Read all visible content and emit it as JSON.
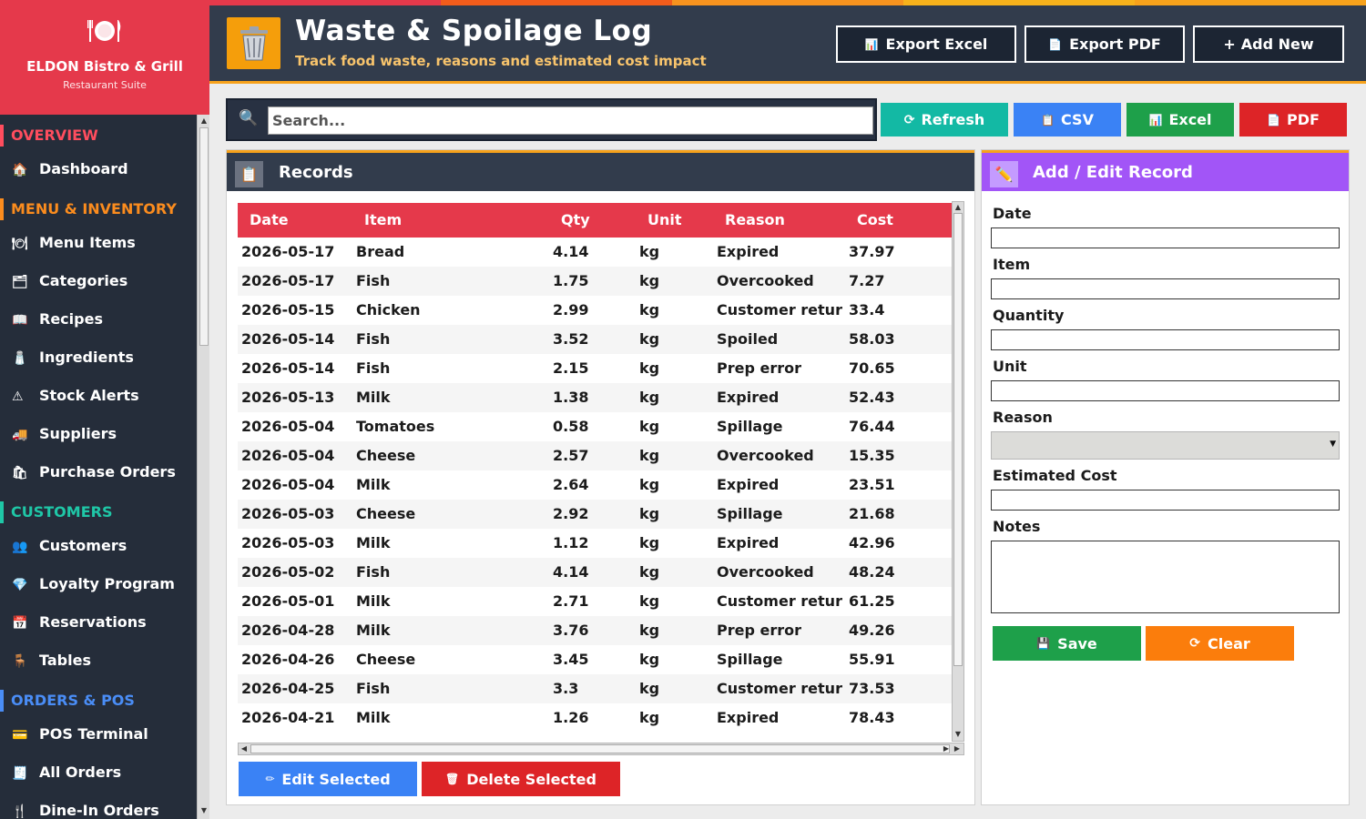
{
  "brand": {
    "logo_icon": "plate-cutlery-icon",
    "name": "ELDON Bistro & Grill",
    "subtitle": "Restaurant Suite",
    "color": "#e5394b"
  },
  "sidebar": {
    "sections": [
      {
        "label": "OVERVIEW",
        "color": "#ff4d5e",
        "items": [
          {
            "icon": "🏠",
            "icon_name": "home-icon",
            "label": "Dashboard"
          }
        ]
      },
      {
        "label": "MENU & INVENTORY",
        "color": "#fb8c1e",
        "items": [
          {
            "icon": "🍽",
            "icon_name": "plate-icon",
            "label": "Menu Items"
          },
          {
            "icon": "🗂",
            "icon_name": "folder-icon",
            "label": "Categories"
          },
          {
            "icon": "📖",
            "icon_name": "book-icon",
            "label": "Recipes"
          },
          {
            "icon": "🧂",
            "icon_name": "ingredient-icon",
            "label": "Ingredients"
          },
          {
            "icon": "⚠",
            "icon_name": "warning-icon",
            "label": "Stock Alerts"
          },
          {
            "icon": "🚚",
            "icon_name": "truck-icon",
            "label": "Suppliers"
          },
          {
            "icon": "🛍",
            "icon_name": "shopping-bag-icon",
            "label": "Purchase Orders"
          }
        ]
      },
      {
        "label": "CUSTOMERS",
        "color": "#1fc7a7",
        "items": [
          {
            "icon": "👥",
            "icon_name": "users-icon",
            "label": "Customers"
          },
          {
            "icon": "💎",
            "icon_name": "diamond-icon",
            "label": "Loyalty Program"
          },
          {
            "icon": "📅",
            "icon_name": "calendar-icon",
            "label": "Reservations"
          },
          {
            "icon": "🪑",
            "icon_name": "chair-icon",
            "label": "Tables"
          }
        ]
      },
      {
        "label": "ORDERS & POS",
        "color": "#4a8df6",
        "items": [
          {
            "icon": "💳",
            "icon_name": "card-icon",
            "label": "POS Terminal"
          },
          {
            "icon": "🧾",
            "icon_name": "receipt-icon",
            "label": "All Orders"
          },
          {
            "icon": "🍴",
            "icon_name": "cutlery-icon",
            "label": "Dine-In Orders"
          }
        ]
      }
    ]
  },
  "header": {
    "icon": "trash-bin-icon",
    "title": "Waste & Spoilage Log",
    "subtitle": "Track food waste, reasons and estimated cost impact",
    "buttons": [
      {
        "icon": "📊",
        "label": "Export Excel"
      },
      {
        "icon": "📄",
        "label": "Export PDF"
      },
      {
        "icon": "+",
        "label": "Add New"
      }
    ],
    "stripe_colors": [
      "#e5394b",
      "#f25c1b",
      "#f7931e",
      "#f7b21b",
      "#f7a21b"
    ]
  },
  "toolbar": {
    "search_placeholder": "Search...",
    "search_icon": "magnifier-icon",
    "buttons": [
      {
        "icon": "⟳",
        "label": "Refresh",
        "color": "#13b9a4"
      },
      {
        "icon": "📋",
        "label": "CSV",
        "color": "#3a82f5"
      },
      {
        "icon": "📊",
        "label": "Excel",
        "color": "#1ea04a"
      },
      {
        "icon": "📄",
        "label": "PDF",
        "color": "#dd2427"
      }
    ]
  },
  "records": {
    "title": "Records",
    "icon": "clipboard-icon",
    "columns": [
      "Date",
      "Item",
      "Qty",
      "Unit",
      "Reason",
      "Cost"
    ],
    "rows": [
      [
        "2026-05-17",
        "Bread",
        "4.14",
        "kg",
        "Expired",
        "37.97"
      ],
      [
        "2026-05-17",
        "Fish",
        "1.75",
        "kg",
        "Overcooked",
        "7.27"
      ],
      [
        "2026-05-15",
        "Chicken",
        "2.99",
        "kg",
        "Customer return",
        "33.4"
      ],
      [
        "2026-05-14",
        "Fish",
        "3.52",
        "kg",
        "Spoiled",
        "58.03"
      ],
      [
        "2026-05-14",
        "Fish",
        "2.15",
        "kg",
        "Prep error",
        "70.65"
      ],
      [
        "2026-05-13",
        "Milk",
        "1.38",
        "kg",
        "Expired",
        "52.43"
      ],
      [
        "2026-05-04",
        "Tomatoes",
        "0.58",
        "kg",
        "Spillage",
        "76.44"
      ],
      [
        "2026-05-04",
        "Cheese",
        "2.57",
        "kg",
        "Overcooked",
        "15.35"
      ],
      [
        "2026-05-04",
        "Milk",
        "2.64",
        "kg",
        "Expired",
        "23.51"
      ],
      [
        "2026-05-03",
        "Cheese",
        "2.92",
        "kg",
        "Spillage",
        "21.68"
      ],
      [
        "2026-05-03",
        "Milk",
        "1.12",
        "kg",
        "Expired",
        "42.96"
      ],
      [
        "2026-05-02",
        "Fish",
        "4.14",
        "kg",
        "Overcooked",
        "48.24"
      ],
      [
        "2026-05-01",
        "Milk",
        "2.71",
        "kg",
        "Customer return",
        "61.25"
      ],
      [
        "2026-04-28",
        "Milk",
        "3.76",
        "kg",
        "Prep error",
        "49.26"
      ],
      [
        "2026-04-26",
        "Cheese",
        "3.45",
        "kg",
        "Spillage",
        "55.91"
      ],
      [
        "2026-04-25",
        "Fish",
        "3.3",
        "kg",
        "Customer return",
        "73.53"
      ],
      [
        "2026-04-21",
        "Milk",
        "1.26",
        "kg",
        "Expired",
        "78.43"
      ]
    ],
    "edit_button": {
      "icon": "✏",
      "label": "Edit Selected",
      "color": "#3a82f5"
    },
    "delete_button": {
      "icon": "🗑",
      "label": "Delete Selected",
      "color": "#dd2427"
    },
    "header_color": "#e5394b"
  },
  "form": {
    "title": "Add / Edit Record",
    "icon": "pencil-icon",
    "fields": {
      "date": {
        "label": "Date",
        "value": ""
      },
      "item": {
        "label": "Item",
        "value": ""
      },
      "quantity": {
        "label": "Quantity",
        "value": ""
      },
      "unit": {
        "label": "Unit",
        "value": ""
      },
      "reason": {
        "label": "Reason",
        "value": ""
      },
      "cost": {
        "label": "Estimated Cost",
        "value": ""
      },
      "notes": {
        "label": "Notes",
        "value": ""
      }
    },
    "save_button": {
      "icon": "💾",
      "label": "Save",
      "color": "#1ea04a"
    },
    "clear_button": {
      "icon": "⟳",
      "label": "Clear",
      "color": "#fb7d0c"
    },
    "header_color": "#a255f7"
  }
}
